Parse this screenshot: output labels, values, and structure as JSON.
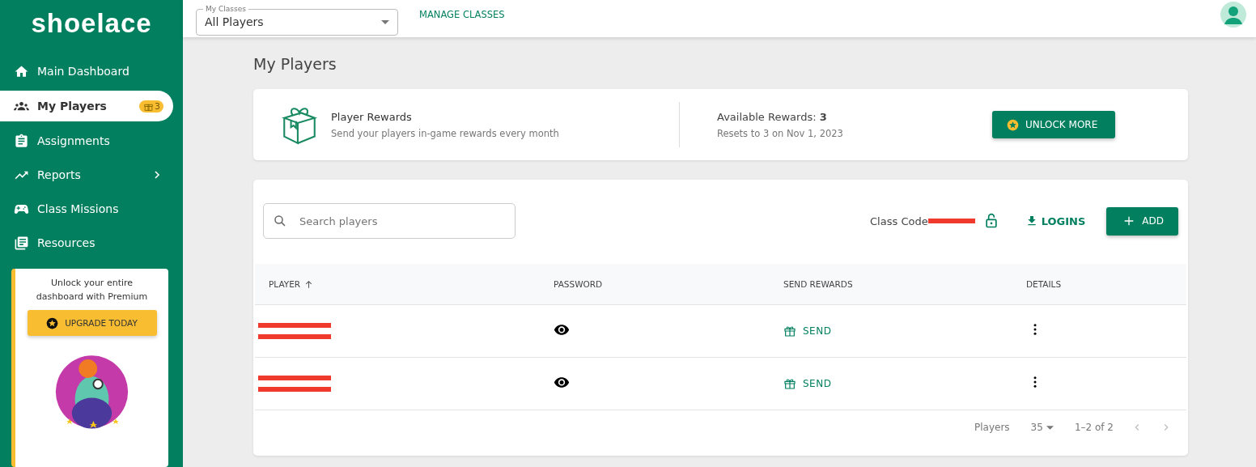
{
  "logo": "shoelace",
  "sidebar": {
    "items": [
      {
        "label": "Main Dashboard",
        "selected": false,
        "expandable": false
      },
      {
        "label": "My Players",
        "selected": true,
        "expandable": false,
        "badge": "3"
      },
      {
        "label": "Assignments",
        "selected": false,
        "expandable": false
      },
      {
        "label": "Reports",
        "selected": false,
        "expandable": true
      },
      {
        "label": "Class Missions",
        "selected": false,
        "expandable": false
      },
      {
        "label": "Resources",
        "selected": false,
        "expandable": false
      }
    ],
    "promo": {
      "text": "Unlock your entire dashboard with Premium",
      "button": "UPGRADE TODAY"
    }
  },
  "topbar": {
    "class_select": {
      "label": "My Classes",
      "value": "All Players"
    },
    "link": "MANAGE CLASSES"
  },
  "page_title": "My Players",
  "rewards": {
    "title": "Player Rewards",
    "subtitle": "Send your players in-game rewards every month",
    "available_label": "Available Rewards:",
    "available_count": "3",
    "resets": "Resets to 3 on Nov 1, 2023",
    "button": "UNLOCK MORE"
  },
  "toolbar": {
    "search": {
      "placeholder": "Search players"
    },
    "class_code_label": "Class Code",
    "logins": "LOGINS",
    "add": "ADD"
  },
  "table": {
    "columns": [
      "PLAYER",
      "PASSWORD",
      "SEND REWARDS",
      "DETAILS"
    ],
    "rows": [
      {
        "send": "SEND"
      },
      {
        "send": "SEND"
      }
    ]
  },
  "pagination": {
    "label": "Players",
    "per_page": "35",
    "range": "1–2 of 2"
  }
}
